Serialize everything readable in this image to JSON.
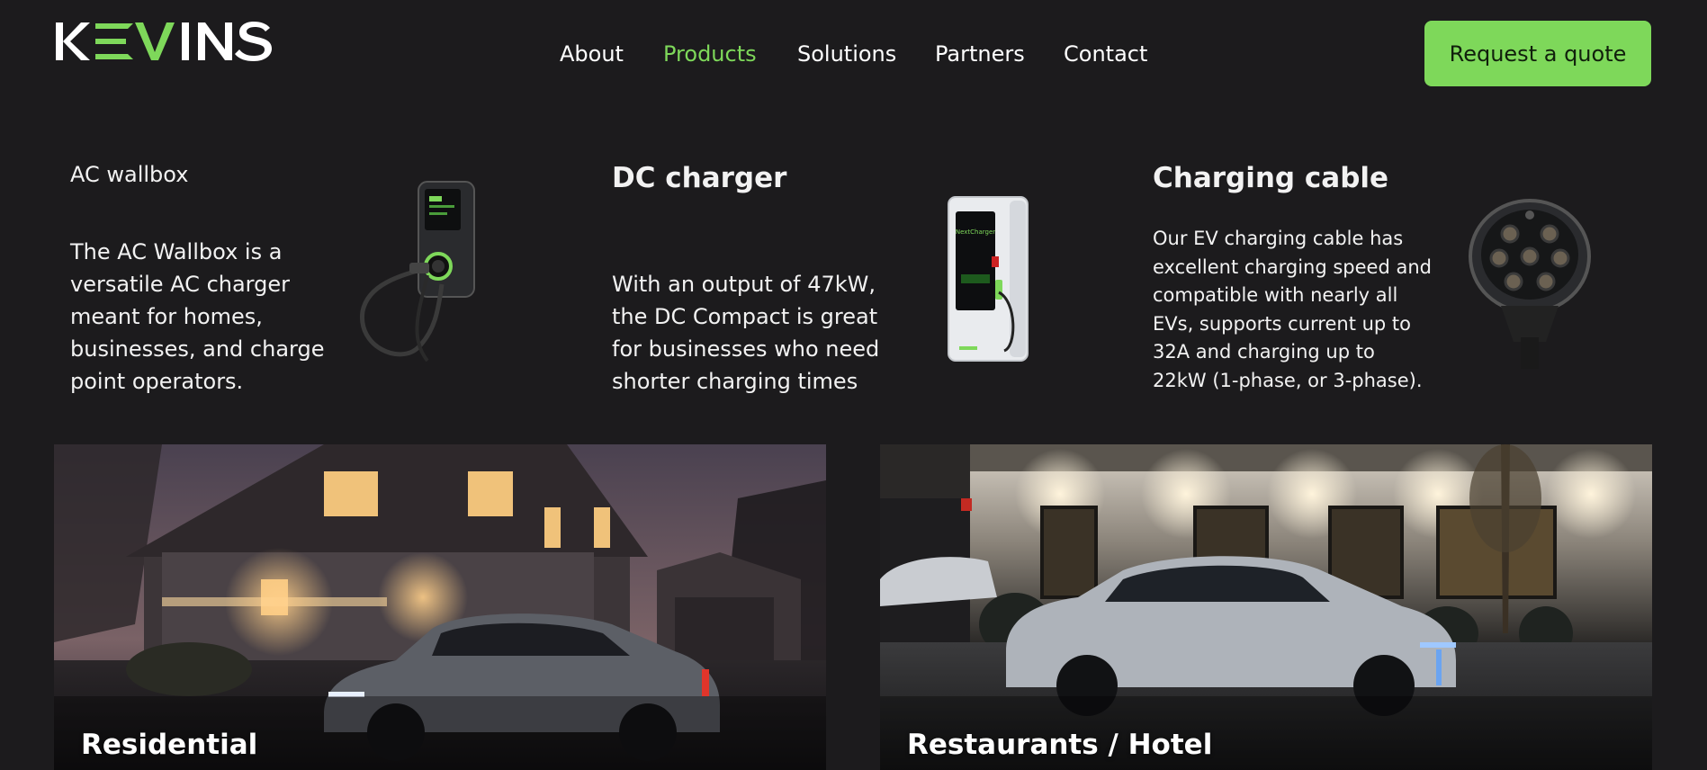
{
  "brand": {
    "logo_text": "KEVINS",
    "accent": "#7ed85a",
    "background": "#1c1b1d"
  },
  "nav": {
    "items": [
      {
        "label": "About",
        "active": false
      },
      {
        "label": "Products",
        "active": true
      },
      {
        "label": "Solutions",
        "active": false
      },
      {
        "label": "Partners",
        "active": false
      },
      {
        "label": "Contact",
        "active": false
      }
    ]
  },
  "header": {
    "cta_label": "Request a quote"
  },
  "products": [
    {
      "title": "AC wallbox",
      "description": "The AC Wallbox is a versatile AC charger meant for homes, businesses, and charge point operators.",
      "image_icon": "ac-wallbox-image"
    },
    {
      "title": "DC charger",
      "description": "With an output of 47kW, the DC Compact is great for businesses who need shorter charging times",
      "image_icon": "dc-charger-image",
      "image_text": "NextCharger"
    },
    {
      "title": "Charging cable",
      "description": "Our EV charging cable has excellent charging speed and compatible with nearly all EVs, supports current up to 32A and charging up to 22kW (1-phase, or 3-phase).",
      "image_icon": "charging-cable-plug-image"
    }
  ],
  "solutions": [
    {
      "label": "Residential",
      "image_icon": "residential-house-car-photo"
    },
    {
      "label": "Restaurants / Hotel",
      "image_icon": "restaurant-hotel-car-photo"
    }
  ]
}
